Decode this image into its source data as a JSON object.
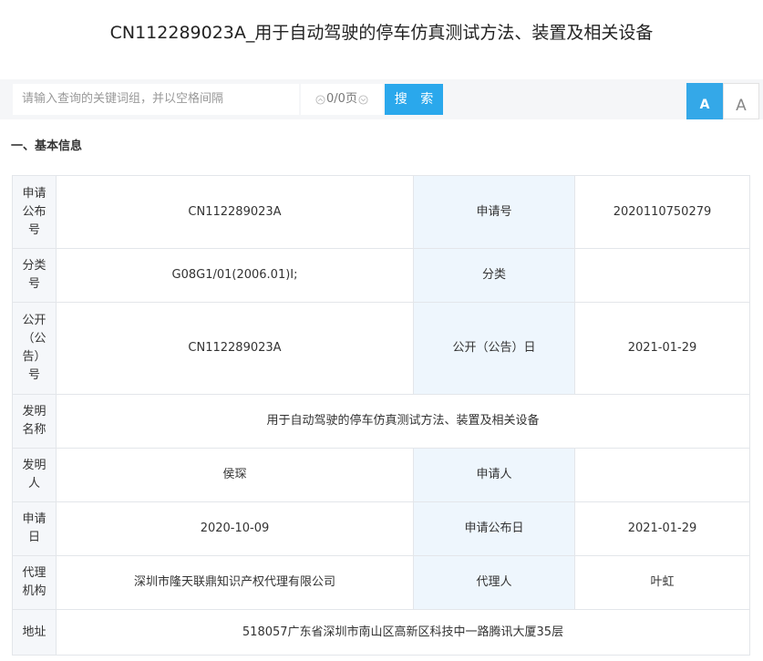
{
  "page": {
    "title": "CN112289023A_用于自动驾驶的停车仿真测试方法、装置及相关设备"
  },
  "search": {
    "placeholder": "请输入查询的关键词组，并以空格间隔",
    "pager": "0/0页",
    "button": "搜 索"
  },
  "font_toggle": {
    "large": "A",
    "small": "A"
  },
  "section": {
    "title": "一、基本信息"
  },
  "table": {
    "rows": [
      {
        "k1": "申请公布号",
        "v1": "CN112289023A",
        "k2": "申请号",
        "v2": "2020110750279"
      },
      {
        "k1": "分类号",
        "v1": "G08G1/01(2006.01)I;",
        "k2": "分类",
        "v2": ""
      },
      {
        "k1": "公开（公告）号",
        "v1": "CN112289023A",
        "k2": "公开（公告）日",
        "v2": "2021-01-29"
      },
      {
        "k1": "发明名称",
        "v_full": "用于自动驾驶的停车仿真测试方法、装置及相关设备"
      },
      {
        "k1": "发明人",
        "v1": "侯琛",
        "k2": "申请人",
        "v2": ""
      },
      {
        "k1": "申请日",
        "v1": "2020-10-09",
        "k2": "申请公布日",
        "v2": "2021-01-29"
      },
      {
        "k1": "代理机构",
        "v1": "深圳市隆天联鼎知识产权代理有限公司",
        "k2": "代理人",
        "v2": "叶虹"
      },
      {
        "k1": "地址",
        "v_full": "518057广东省深圳市南山区高新区科技中一路腾讯大厦35层"
      }
    ]
  }
}
